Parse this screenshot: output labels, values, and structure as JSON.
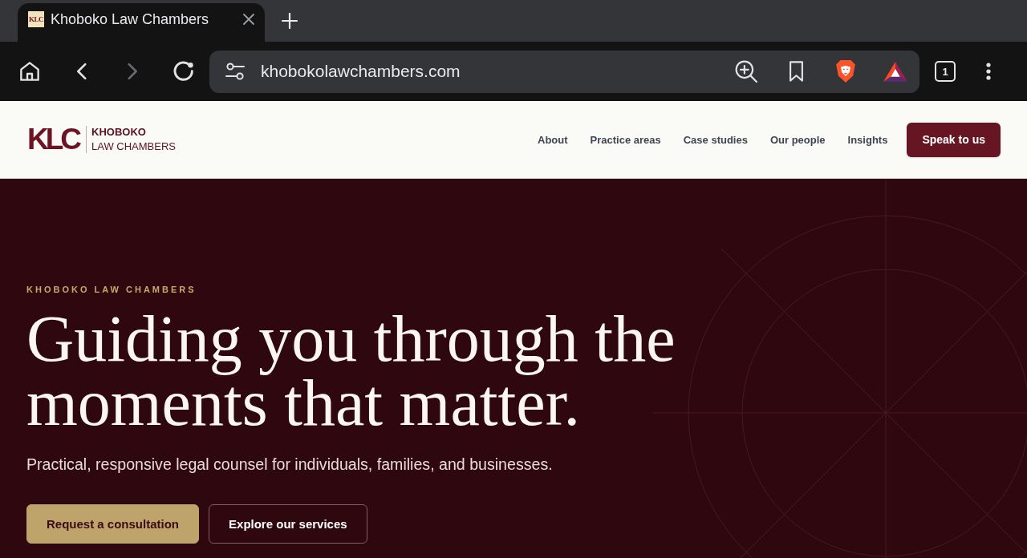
{
  "browser": {
    "tabs": [
      {
        "title": "Khoboko Law Chambers",
        "favicon_text": "KLC",
        "selected": true
      }
    ],
    "toolbar_buttons": [
      {
        "kind": "home",
        "disabled": false
      },
      {
        "kind": "back",
        "disabled": false
      },
      {
        "kind": "forward",
        "disabled": true
      },
      {
        "kind": "reload",
        "disabled": false
      }
    ],
    "address_bar": {
      "url": "khobokolawchambers.com"
    },
    "tab_count": "1"
  },
  "header": {
    "logo": {
      "monogram": "KLC",
      "name_lines": [
        "KHOBOKO",
        "LAW CHAMBERS"
      ]
    },
    "nav": [
      {
        "label": "About"
      },
      {
        "label": "Practice areas"
      },
      {
        "label": "Case studies"
      },
      {
        "label": "Our people"
      },
      {
        "label": "Insights"
      }
    ],
    "cta": "Speak to us"
  },
  "hero": {
    "eyebrow": "KHOBOKO LAW CHAMBERS",
    "heading": "Guiding you through the moments that matter.",
    "subheading": "Practical, responsive legal counsel for individuals, families, and businesses.",
    "buttons": [
      {
        "label": "Request a consultation",
        "kind": "primary"
      },
      {
        "label": "Explore our services",
        "kind": "outline"
      }
    ]
  }
}
